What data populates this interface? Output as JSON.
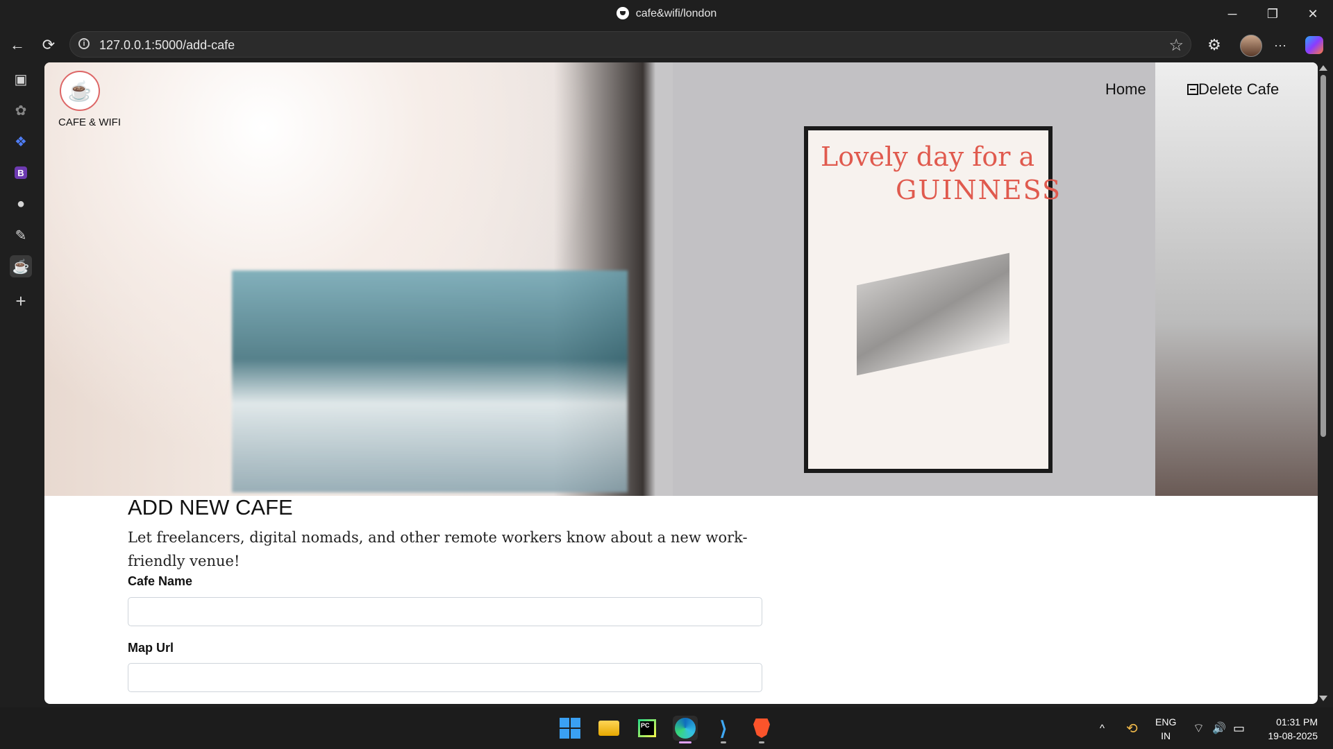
{
  "window": {
    "title": "cafe&wifi/london",
    "minimize": "─",
    "restore": "❐",
    "close": "✕"
  },
  "browser": {
    "url": "127.0.0.1:5000/add-cafe",
    "back": "←",
    "reload": "⟳",
    "more": "···",
    "bookmark_star": "☆",
    "extensions": "⚙"
  },
  "sidebar": {
    "items": [
      {
        "name": "tab-actions-icon",
        "glyph": "▣"
      },
      {
        "name": "openai-icon",
        "glyph": "✿"
      },
      {
        "name": "dropbox-icon",
        "glyph": "❖"
      },
      {
        "name": "bootstrap-icon",
        "glyph": "B"
      },
      {
        "name": "github-icon",
        "glyph": "●"
      },
      {
        "name": "flask-icon",
        "glyph": "✎"
      },
      {
        "name": "cafe-app-icon",
        "glyph": "☕"
      },
      {
        "name": "add-icon",
        "glyph": "+"
      }
    ]
  },
  "site": {
    "logo_text": "CAFE & WIFI",
    "nav": {
      "home": "Home",
      "delete": "Delete Cafe"
    },
    "poster": {
      "line1": "Lovely day for a",
      "line2": "GUINNESS"
    },
    "heading": "ADD NEW CAFE",
    "lead": "Let freelancers, digital nomads, and other remote workers know about a new work-friendly venue!",
    "form": {
      "cafe_name_label": "Cafe Name",
      "cafe_name_value": "",
      "map_url_label": "Map Url",
      "map_url_value": ""
    }
  },
  "taskbar": {
    "apps": [
      "windows-start",
      "file-explorer",
      "pycharm",
      "edge",
      "vscode",
      "brave"
    ],
    "pycharm_label": "PC",
    "vscode_glyph": "⟩",
    "tray": {
      "chevron": "^",
      "sync": "⟲",
      "lang_top": "ENG",
      "lang_bottom": "IN",
      "wifi": "⌔",
      "volume": "🔊",
      "battery": "▭",
      "time": "01:31 PM",
      "date": "19-08-2025"
    }
  }
}
